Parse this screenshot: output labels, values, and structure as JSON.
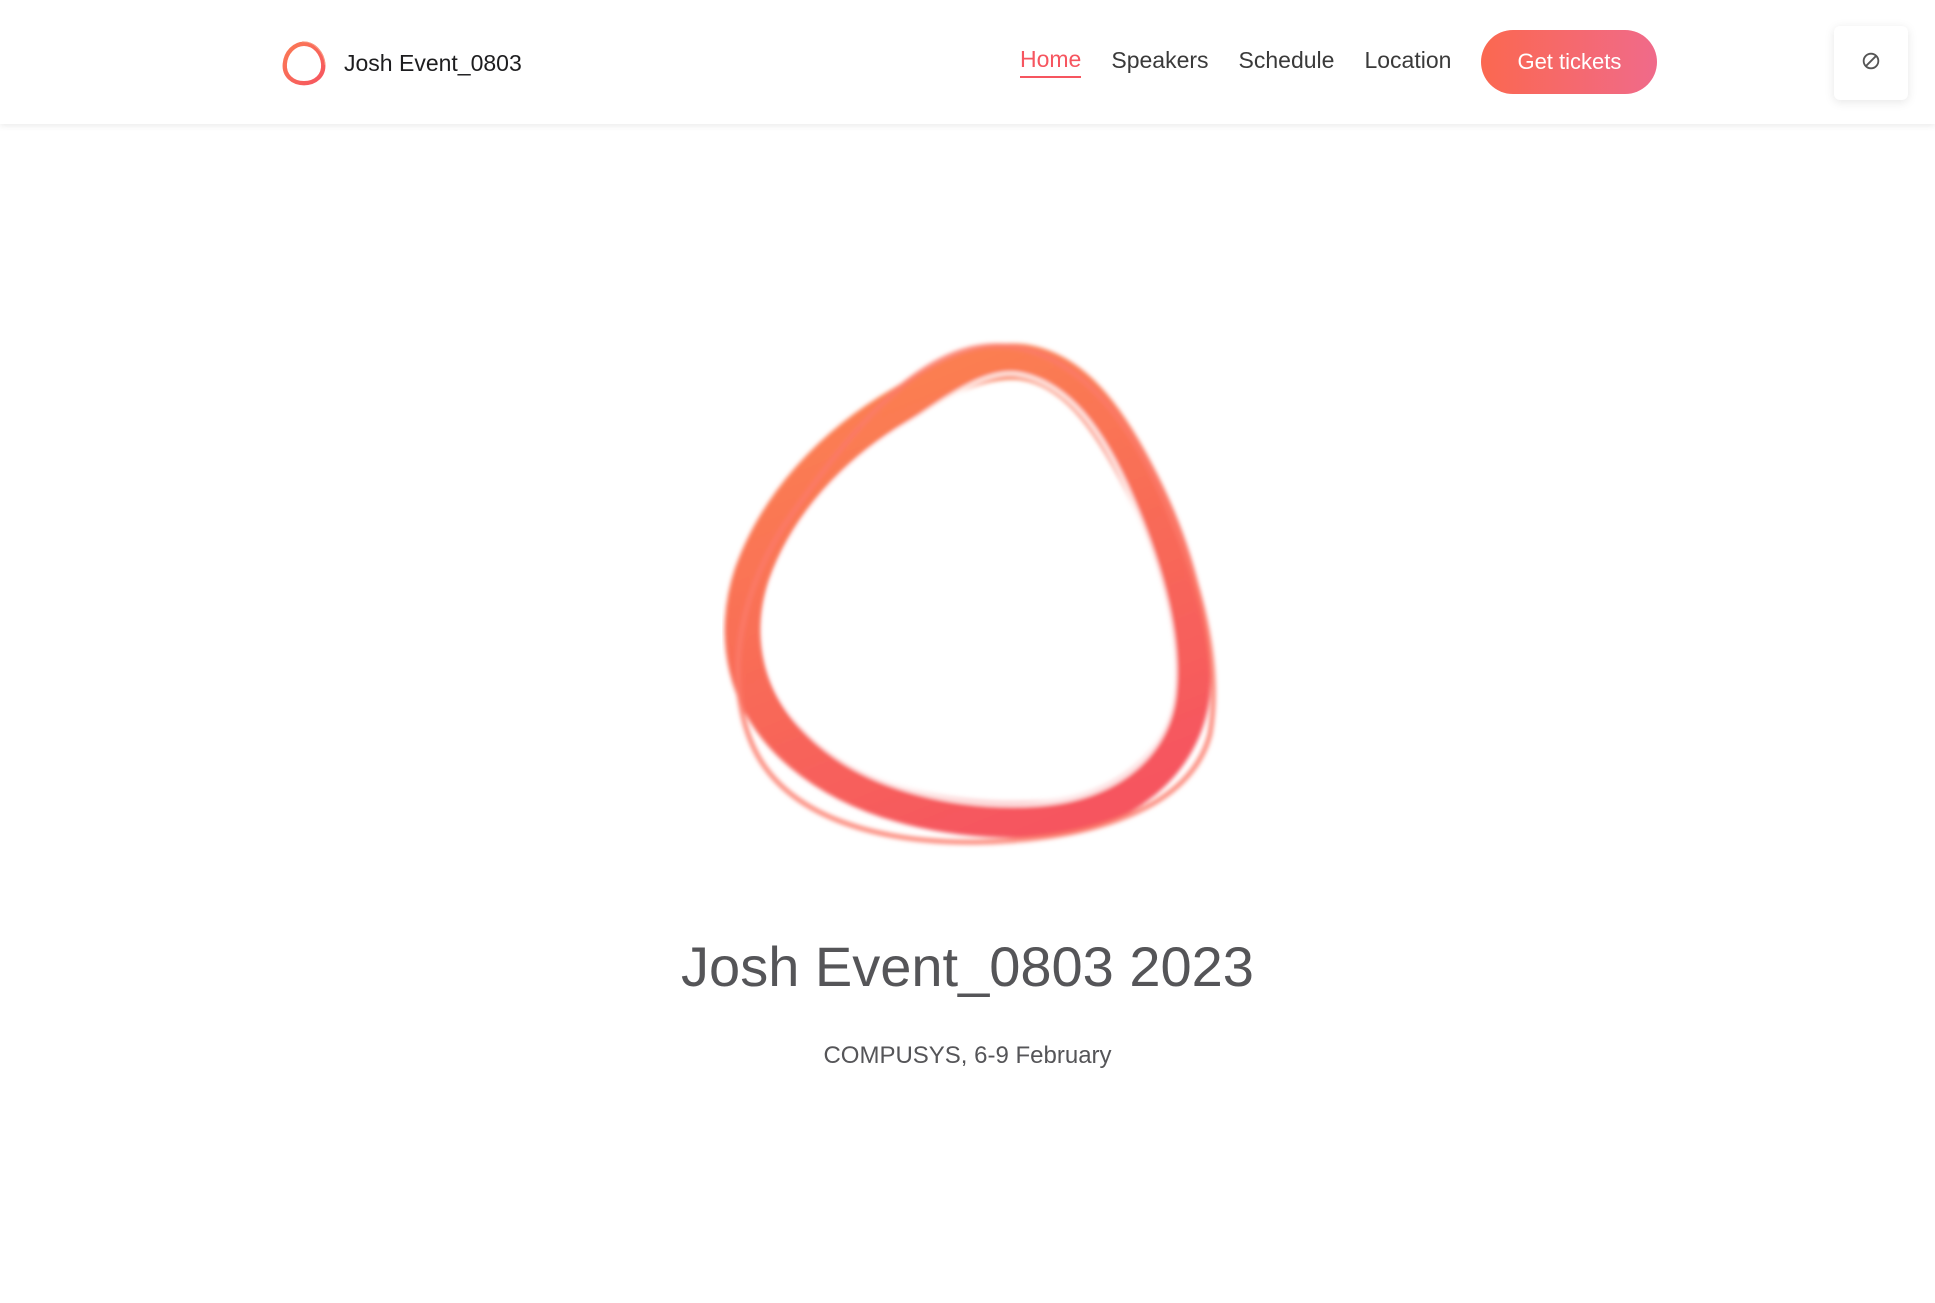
{
  "header": {
    "brand_name": "Josh Event_0803",
    "brand_logo_icon": "ring-logo-icon",
    "nav": [
      {
        "label": "Home",
        "active": true
      },
      {
        "label": "Speakers",
        "active": false
      },
      {
        "label": "Schedule",
        "active": false
      },
      {
        "label": "Location",
        "active": false
      }
    ],
    "cta_label": "Get tickets",
    "side_toggle_icon": "slash-circle-icon"
  },
  "hero": {
    "logo_icon": "ring-logo-icon",
    "title": "Josh Event_0803 2023",
    "subtitle": "COMPUSYS, 6-9 February"
  },
  "colors": {
    "accent": "#f6555f",
    "gradient_start": "#fb6850",
    "gradient_end": "#f06a8a",
    "text": "#555558",
    "nav_text": "#3a3a3a"
  }
}
